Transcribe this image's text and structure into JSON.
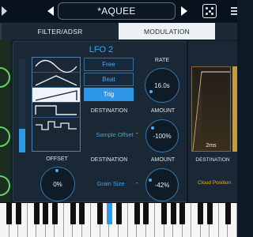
{
  "header": {
    "preset_name": "*AQUEE",
    "prev_icon": "triangle-left-icon",
    "next_icon": "triangle-right-icon",
    "random_icon": "dice-icon",
    "menu_icon": "menu-icon"
  },
  "tabs": [
    {
      "label": "FILTER/ADSR",
      "active": false
    },
    {
      "label": "MODULATION",
      "active": true
    }
  ],
  "lfo": {
    "title": "LFO 2",
    "waveforms": [
      "sine",
      "triangle",
      "ramp",
      "square",
      "random-step"
    ],
    "selected_waveform": "ramp",
    "modes": [
      {
        "label": "Free",
        "active": false
      },
      {
        "label": "Beat",
        "active": false
      },
      {
        "label": "Trig",
        "active": true
      }
    ],
    "rate": {
      "label": "RATE",
      "value": "16.0s"
    },
    "destination_1": {
      "label": "DESTINATION",
      "value": "Sample Offset",
      "separator": "-"
    },
    "amount_1": {
      "label": "AMOUNT",
      "value": "-100%"
    },
    "offset": {
      "label": "OFFSET",
      "value": "0%"
    },
    "destination_2": {
      "label": "DESTINATION",
      "value": "Grain Size",
      "separator": "-"
    },
    "amount_2": {
      "label": "AMOUNT",
      "value": "-42%"
    }
  },
  "envelope": {
    "time": "2ms",
    "destination_label": "DESTINATION",
    "destination_value": "Cloud Position"
  },
  "colors": {
    "accent_blue": "#2d97e6",
    "accent_orange": "#f0a826",
    "accent_green": "#5fd36a"
  }
}
